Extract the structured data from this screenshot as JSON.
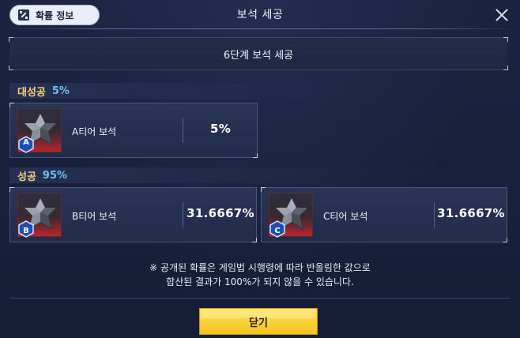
{
  "header": {
    "probability_button": "확률 정보",
    "title": "보석 세공",
    "close_icon": "close-icon"
  },
  "stage_banner": "6단계 보석 세공",
  "sections": [
    {
      "name": "대성공",
      "percent": "5%",
      "items": [
        {
          "tier": "A",
          "name": "A티어 보석",
          "percent": "5%"
        }
      ]
    },
    {
      "name": "성공",
      "percent": "95%",
      "items": [
        {
          "tier": "B",
          "name": "B티어 보석",
          "percent": "31.6667%"
        },
        {
          "tier": "C",
          "name": "C티어 보석",
          "percent": "31.6667%"
        }
      ]
    }
  ],
  "notice": {
    "line1": "※ 공개된 확률은 게임법 시행령에 따라 반올림한 값으로",
    "line2": "합산된 결과가 100%가 되지 않을 수 있습니다."
  },
  "confirm_button": "닫기",
  "colors": {
    "section_name": "#f3d37a",
    "section_percent": "#6fc0f2",
    "confirm_button": "#f7cf2b",
    "gem_background_accent": "#b8252c",
    "tier_badge": "#1d4fb0"
  }
}
